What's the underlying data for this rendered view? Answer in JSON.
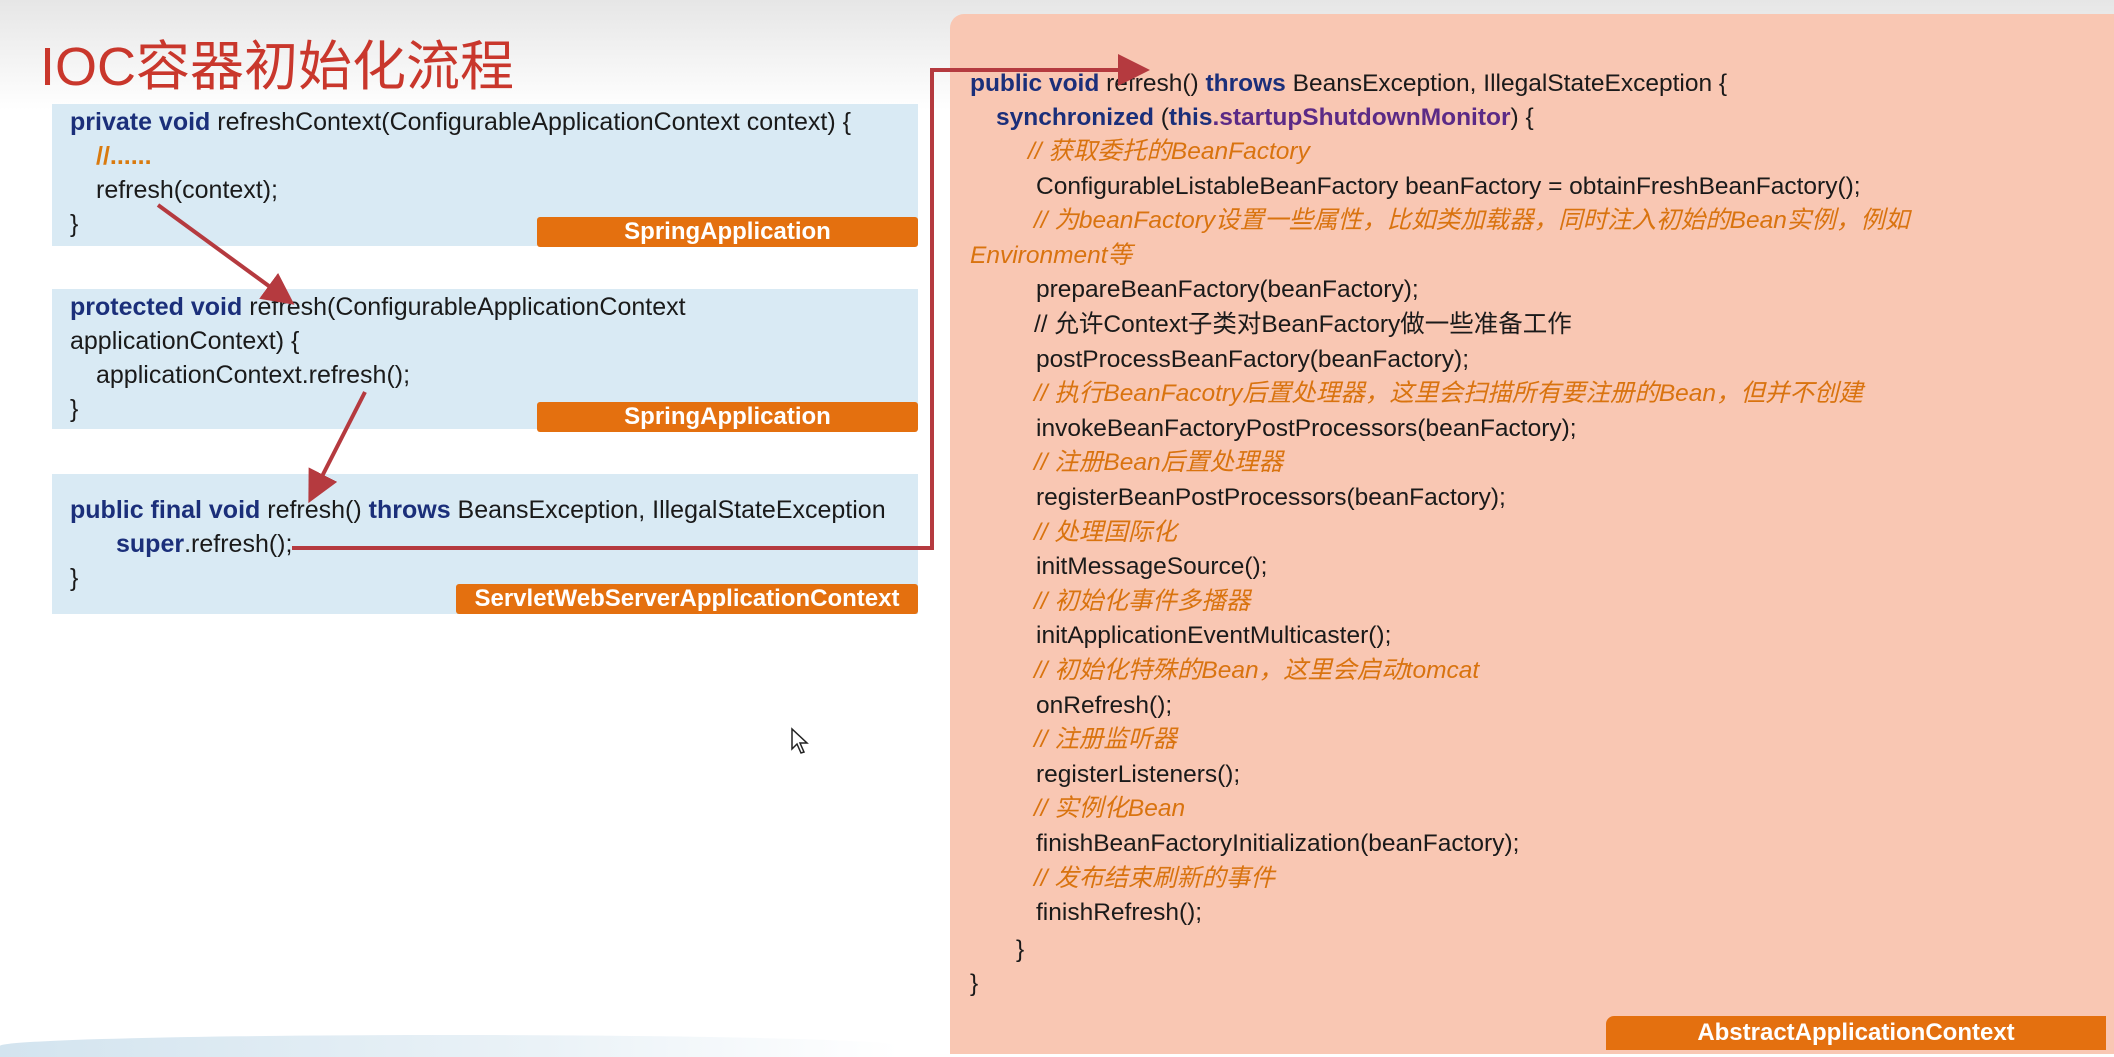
{
  "title": "IOC容器初始化流程",
  "left_boxes": [
    {
      "lines": [
        {
          "kw": "private void",
          "text": " refreshContext(ConfigurableApplicationContext context) {"
        },
        {
          "comment": "//......"
        },
        {
          "text": "refresh(context);"
        },
        {
          "text": "}"
        }
      ],
      "label": "SpringApplication"
    },
    {
      "lines": [
        {
          "kw": "protected void",
          "text": " refresh(ConfigurableApplicationContext"
        },
        {
          "text": "applicationContext) {"
        },
        {
          "text": "applicationContext.refresh();"
        },
        {
          "text": "}"
        }
      ],
      "label": "SpringApplication"
    },
    {
      "lines": [
        {
          "kw": "public final void",
          "text": " refresh() ",
          "kw2": "throws",
          "text2": " BeansException, IllegalStateException"
        },
        {
          "kw": "super",
          "text": ".refresh();"
        },
        {
          "text": "}"
        }
      ],
      "label": "ServletWebServerApplicationContext"
    }
  ],
  "right": {
    "signature": {
      "kw": "public void",
      "text": " refresh() ",
      "kw2": "throws",
      "text2": " BeansException, IllegalStateException {"
    },
    "sync": {
      "kw": "synchronized",
      "text1": " (",
      "kw2": "this",
      "field": ".startupShutdownMonitor",
      "text2": ") {"
    },
    "body": [
      {
        "type": "comment",
        "text": "// 获取委托的BeanFactory"
      },
      {
        "type": "code",
        "text": "ConfigurableListableBeanFactory beanFactory = obtainFreshBeanFactory();"
      },
      {
        "type": "comment",
        "text": "// 为beanFactory设置一些属性，比如类加载器，同时注入初始的Bean实例，例如"
      },
      {
        "type": "comment-wrap",
        "text": "Environment等"
      },
      {
        "type": "code",
        "text": "prepareBeanFactory(beanFactory);"
      },
      {
        "type": "plain",
        "text": "// 允许Context子类对BeanFactory做一些准备工作"
      },
      {
        "type": "code",
        "text": "postProcessBeanFactory(beanFactory);"
      },
      {
        "type": "comment",
        "text": "// 执行BeanFacotry后置处理器，这里会扫描所有要注册的Bean，但并不创建"
      },
      {
        "type": "code",
        "text": "invokeBeanFactoryPostProcessors(beanFactory);"
      },
      {
        "type": "comment",
        "text": "// 注册Bean后置处理器"
      },
      {
        "type": "code",
        "text": "registerBeanPostProcessors(beanFactory);"
      },
      {
        "type": "comment",
        "text": "// 处理国际化"
      },
      {
        "type": "code",
        "text": "initMessageSource();"
      },
      {
        "type": "comment",
        "text": "// 初始化事件多播器"
      },
      {
        "type": "code",
        "text": "initApplicationEventMulticaster();"
      },
      {
        "type": "comment",
        "text": "// 初始化特殊的Bean，这里会启动tomcat"
      },
      {
        "type": "code",
        "text": "onRefresh();"
      },
      {
        "type": "comment",
        "text": "// 注册监听器"
      },
      {
        "type": "code",
        "text": "registerListeners();"
      },
      {
        "type": "comment",
        "text": "// 实例化Bean"
      },
      {
        "type": "code",
        "text": "finishBeanFactoryInitialization(beanFactory);"
      },
      {
        "type": "comment",
        "text": "// 发布结束刷新的事件"
      },
      {
        "type": "code",
        "text": "finishRefresh();"
      }
    ],
    "close_inner": "}",
    "close_outer": "}",
    "label": "AbstractApplicationContext"
  },
  "colors": {
    "arrow": "#b53a3f",
    "keyword": "#1b2f7a",
    "comment": "#d9730f",
    "label_bg": "#e4700f",
    "left_box_bg": "#d9eaf4",
    "right_panel_bg": "#f9c7b3",
    "title": "#c9372c"
  },
  "icons": {
    "cursor": "mouse-pointer-icon"
  }
}
